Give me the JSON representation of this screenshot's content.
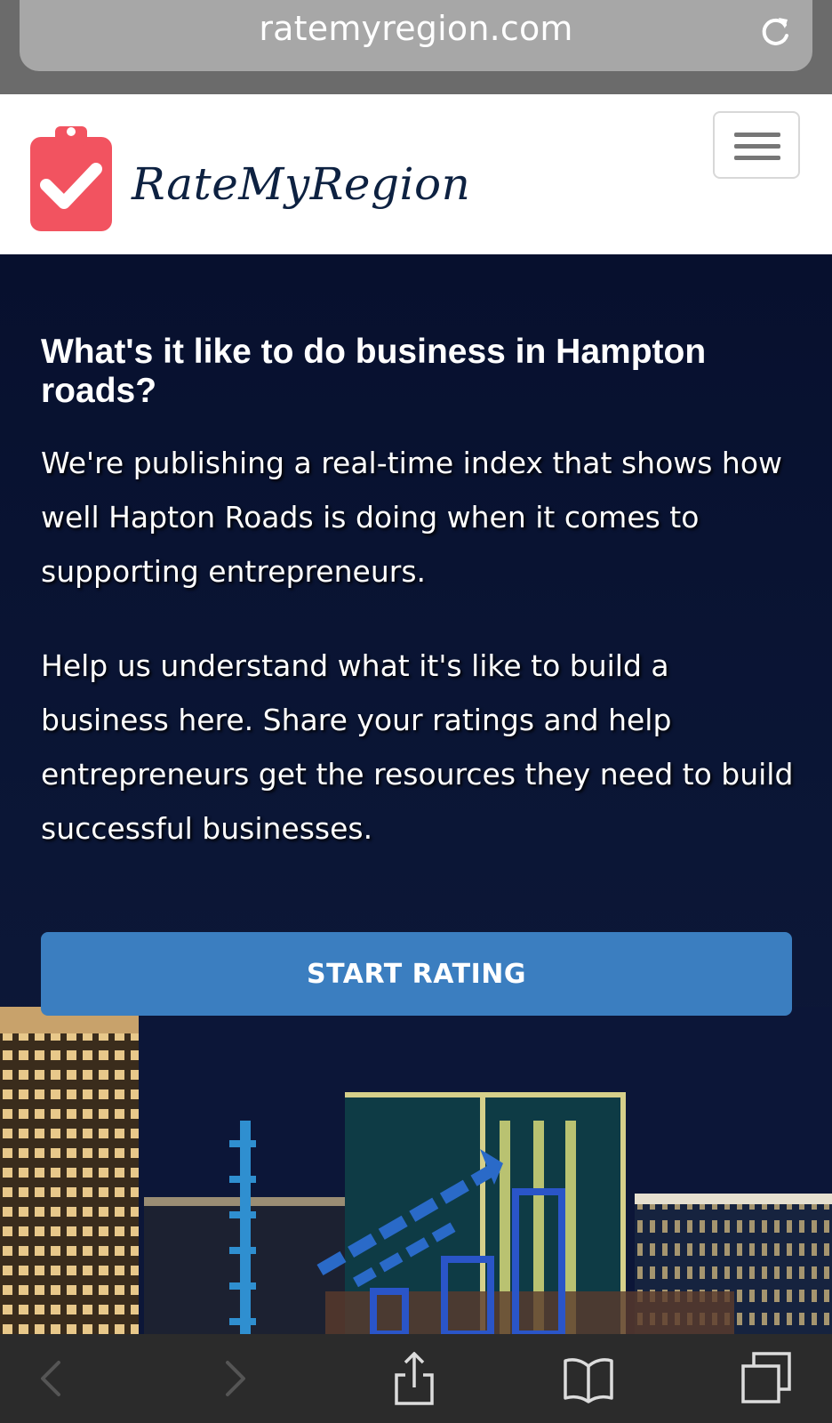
{
  "browser": {
    "url": "ratemyregion.com",
    "toolbar_icons": [
      "back-arrow-icon",
      "forward-arrow-icon",
      "share-icon",
      "bookmarks-icon",
      "tabs-icon"
    ]
  },
  "navbar": {
    "brand": "RateMyRegion",
    "logo_icon": "clipboard-check-icon",
    "menu_icon": "hamburger-menu-icon"
  },
  "hero": {
    "heading": "What's it like to do business in Hampton roads?",
    "paragraph_1": "We're publishing a real-time index that shows how well Hapton Roads is doing when it comes to supporting entrepreneurs.",
    "paragraph_2": "Help us understand what it's like to build a business here. Share your ratings and help entrepreneurs get the resources they need to build successful businesses.",
    "cta_label": "START RATING"
  },
  "colors": {
    "brand_red": "#f25360",
    "brand_navy": "#0d2141",
    "cta_blue": "#3b7ec0",
    "hero_bg": "#07102e"
  }
}
